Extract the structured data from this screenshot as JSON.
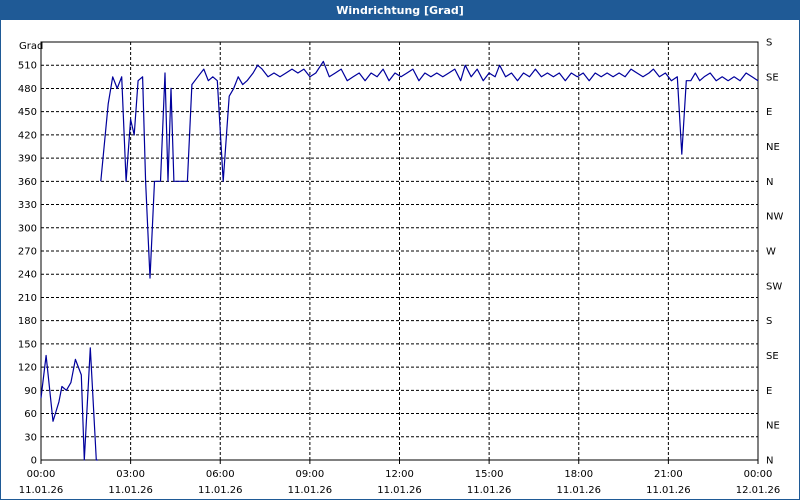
{
  "window": {
    "title": "Windrichtung [Grad]"
  },
  "chart_data": {
    "type": "line",
    "title": "Windrichtung [Grad]",
    "ylabel": "Grad",
    "xlabel": "",
    "x_unit": "hours since 11.01.26 00:00",
    "xlim": [
      0,
      24
    ],
    "ylim": [
      0,
      540
    ],
    "grid": true,
    "x_ticks": [
      {
        "time": "00:00",
        "date": "11.01.26",
        "x": 0
      },
      {
        "time": "03:00",
        "date": "11.01.26",
        "x": 3
      },
      {
        "time": "06:00",
        "date": "11.01.26",
        "x": 6
      },
      {
        "time": "09:00",
        "date": "11.01.26",
        "x": 9
      },
      {
        "time": "12:00",
        "date": "11.01.26",
        "x": 12
      },
      {
        "time": "15:00",
        "date": "11.01.26",
        "x": 15
      },
      {
        "time": "18:00",
        "date": "11.01.26",
        "x": 18
      },
      {
        "time": "21:00",
        "date": "11.01.26",
        "x": 21
      },
      {
        "time": "00:00",
        "date": "12.01.26",
        "x": 24
      }
    ],
    "y_ticks": [
      0,
      30,
      60,
      90,
      120,
      150,
      180,
      210,
      240,
      270,
      300,
      330,
      360,
      390,
      420,
      450,
      480,
      510
    ],
    "right_axis": [
      {
        "label": "N",
        "y": 0
      },
      {
        "label": "NE",
        "y": 45
      },
      {
        "label": "E",
        "y": 90
      },
      {
        "label": "SE",
        "y": 135
      },
      {
        "label": "S",
        "y": 180
      },
      {
        "label": "SW",
        "y": 225
      },
      {
        "label": "W",
        "y": 270
      },
      {
        "label": "NW",
        "y": 315
      },
      {
        "label": "N",
        "y": 360
      },
      {
        "label": "NE",
        "y": 405
      },
      {
        "label": "E",
        "y": 450
      },
      {
        "label": "SE",
        "y": 495
      },
      {
        "label": "S",
        "y": 540
      }
    ],
    "line_color": "#00009c",
    "series": [
      {
        "segments": [
          [
            [
              0.0,
              80
            ],
            [
              0.17,
              135
            ],
            [
              0.4,
              50
            ],
            [
              0.6,
              75
            ],
            [
              0.7,
              95
            ],
            [
              0.85,
              90
            ],
            [
              1.0,
              100
            ],
            [
              1.15,
              130
            ],
            [
              1.35,
              110
            ],
            [
              1.45,
              0
            ],
            [
              1.65,
              145
            ],
            [
              1.85,
              0
            ],
            [
              1.9,
              0
            ]
          ],
          [
            [
              2.0,
              360
            ],
            [
              2.25,
              460
            ],
            [
              2.4,
              495
            ],
            [
              2.55,
              480
            ],
            [
              2.7,
              495
            ],
            [
              2.85,
              360
            ],
            [
              3.0,
              440
            ],
            [
              3.12,
              420
            ],
            [
              3.25,
              490
            ],
            [
              3.4,
              495
            ],
            [
              3.5,
              360
            ],
            [
              3.65,
              235
            ],
            [
              3.8,
              360
            ],
            [
              4.0,
              360
            ],
            [
              4.15,
              500
            ],
            [
              4.25,
              360
            ],
            [
              4.35,
              480
            ],
            [
              4.45,
              360
            ],
            [
              4.6,
              360
            ],
            [
              4.75,
              360
            ],
            [
              4.9,
              360
            ],
            [
              5.05,
              485
            ],
            [
              5.25,
              495
            ],
            [
              5.45,
              505
            ],
            [
              5.6,
              490
            ],
            [
              5.75,
              495
            ],
            [
              5.9,
              490
            ],
            [
              6.1,
              360
            ],
            [
              6.3,
              470
            ],
            [
              6.45,
              480
            ],
            [
              6.6,
              495
            ],
            [
              6.75,
              485
            ],
            [
              6.9,
              490
            ],
            [
              7.1,
              500
            ],
            [
              7.25,
              510
            ],
            [
              7.4,
              505
            ],
            [
              7.6,
              495
            ],
            [
              7.8,
              500
            ],
            [
              8.0,
              495
            ],
            [
              8.2,
              500
            ],
            [
              8.4,
              505
            ],
            [
              8.6,
              500
            ],
            [
              8.8,
              505
            ],
            [
              9.0,
              495
            ],
            [
              9.2,
              500
            ],
            [
              9.45,
              515
            ],
            [
              9.65,
              495
            ],
            [
              9.85,
              500
            ],
            [
              10.05,
              505
            ],
            [
              10.25,
              490
            ],
            [
              10.45,
              495
            ],
            [
              10.65,
              500
            ],
            [
              10.85,
              490
            ],
            [
              11.05,
              500
            ],
            [
              11.25,
              495
            ],
            [
              11.45,
              505
            ],
            [
              11.65,
              490
            ],
            [
              11.85,
              500
            ],
            [
              12.05,
              495
            ],
            [
              12.25,
              500
            ],
            [
              12.45,
              505
            ],
            [
              12.65,
              490
            ],
            [
              12.85,
              500
            ],
            [
              13.05,
              495
            ],
            [
              13.25,
              500
            ],
            [
              13.45,
              495
            ],
            [
              13.65,
              500
            ],
            [
              13.85,
              505
            ],
            [
              14.05,
              490
            ],
            [
              14.2,
              510
            ],
            [
              14.4,
              495
            ],
            [
              14.6,
              505
            ],
            [
              14.8,
              490
            ],
            [
              15.0,
              500
            ],
            [
              15.2,
              495
            ],
            [
              15.35,
              510
            ],
            [
              15.55,
              495
            ],
            [
              15.75,
              500
            ],
            [
              15.95,
              490
            ],
            [
              16.15,
              500
            ],
            [
              16.35,
              495
            ],
            [
              16.55,
              505
            ],
            [
              16.75,
              495
            ],
            [
              16.95,
              500
            ],
            [
              17.15,
              495
            ],
            [
              17.35,
              500
            ],
            [
              17.55,
              490
            ],
            [
              17.75,
              500
            ],
            [
              17.95,
              495
            ],
            [
              18.15,
              500
            ],
            [
              18.35,
              490
            ],
            [
              18.55,
              500
            ],
            [
              18.75,
              495
            ],
            [
              18.95,
              500
            ],
            [
              19.15,
              495
            ],
            [
              19.35,
              500
            ],
            [
              19.55,
              495
            ],
            [
              19.75,
              505
            ],
            [
              19.95,
              500
            ],
            [
              20.15,
              495
            ],
            [
              20.35,
              500
            ],
            [
              20.5,
              505
            ],
            [
              20.7,
              495
            ],
            [
              20.9,
              500
            ],
            [
              21.1,
              490
            ],
            [
              21.3,
              495
            ],
            [
              21.45,
              395
            ],
            [
              21.6,
              490
            ],
            [
              21.75,
              490
            ],
            [
              21.9,
              500
            ],
            [
              22.05,
              490
            ],
            [
              22.2,
              495
            ],
            [
              22.4,
              500
            ],
            [
              22.6,
              490
            ],
            [
              22.8,
              495
            ],
            [
              23.0,
              490
            ],
            [
              23.2,
              495
            ],
            [
              23.4,
              490
            ],
            [
              23.6,
              500
            ],
            [
              23.8,
              495
            ],
            [
              24.0,
              490
            ]
          ]
        ]
      }
    ]
  }
}
